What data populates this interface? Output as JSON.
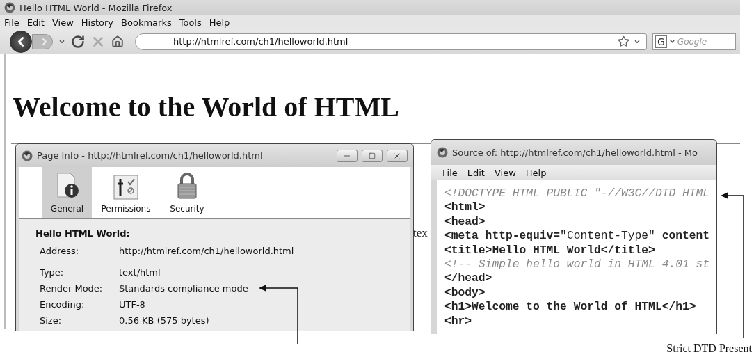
{
  "browser": {
    "title": "Hello HTML World - Mozilla Firefox",
    "menu": [
      "File",
      "Edit",
      "View",
      "History",
      "Bookmarks",
      "Tools",
      "Help"
    ],
    "url": "http://htmlref.com/ch1/helloworld.html",
    "search_engine": "G",
    "search_placeholder": "Google"
  },
  "page": {
    "heading": "Welcome to the World of HTML",
    "partial_text": "tex"
  },
  "page_info": {
    "title": "Page Info - http://htmlref.com/ch1/helloworld.html",
    "tabs": [
      {
        "label": "General",
        "selected": true
      },
      {
        "label": "Permissions",
        "selected": false
      },
      {
        "label": "Security",
        "selected": false
      }
    ],
    "heading": "Hello HTML World:",
    "fields": [
      {
        "label": "Address:",
        "value": "http://htmlref.com/ch1/helloworld.html"
      },
      {
        "label": "Type:",
        "value": "text/html"
      },
      {
        "label": "Render Mode:",
        "value": "Standards compliance mode"
      },
      {
        "label": "Encoding:",
        "value": "UTF-8"
      },
      {
        "label": "Size:",
        "value": "0.56 KB (575 bytes)"
      }
    ]
  },
  "source": {
    "title": "Source of: http://htmlref.com/ch1/helloworld.html - Mo",
    "menu": [
      "File",
      "Edit",
      "View",
      "Help"
    ],
    "lines": [
      {
        "kind": "comment",
        "text": "<!DOCTYPE HTML PUBLIC \"-//W3C//DTD HTML"
      },
      {
        "kind": "markup",
        "text": "<html>"
      },
      {
        "kind": "markup",
        "text": "<head>"
      },
      {
        "kind": "markup",
        "text": "**<meta http-equiv=**\"Content-Type\" **content**"
      },
      {
        "kind": "markup",
        "text": "<title>Hello HTML World</title>"
      },
      {
        "kind": "comment",
        "text": "<!-- Simple hello world in HTML 4.01 st"
      },
      {
        "kind": "markup",
        "text": "</head>"
      },
      {
        "kind": "markup",
        "text": "<body>"
      },
      {
        "kind": "markup",
        "text": "<h1>Welcome to the World of HTML</h1>"
      },
      {
        "kind": "markup",
        "text": "<hr>"
      }
    ]
  },
  "annotations": [
    {
      "label": "Strict DTD Present"
    }
  ]
}
